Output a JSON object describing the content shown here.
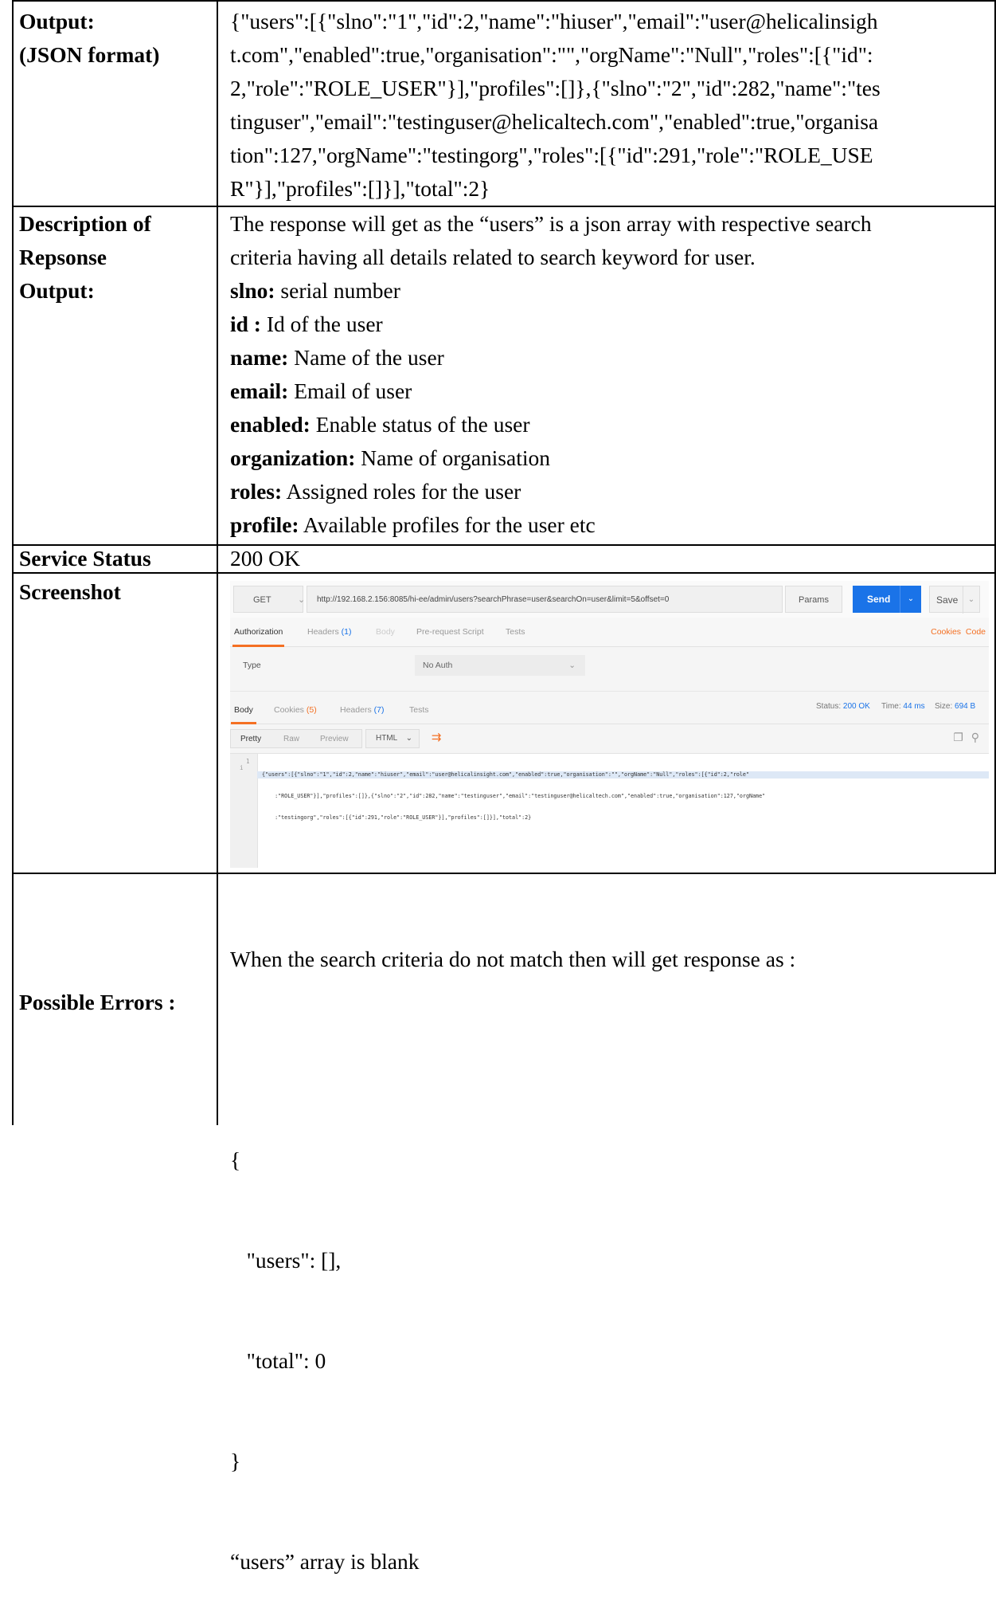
{
  "rows": {
    "output": {
      "label_lines": [
        "Output:",
        "(JSON format)"
      ],
      "value_lines": [
        "{\"users\":[{\"slno\":\"1\",\"id\":2,\"name\":\"hiuser\",\"email\":\"user@helicalinsigh",
        "t.com\",\"enabled\":true,\"organisation\":\"\",\"orgName\":\"Null\",\"roles\":[{\"id\":",
        "2,\"role\":\"ROLE_USER\"}],\"profiles\":[]},{\"slno\":\"2\",\"id\":282,\"name\":\"tes",
        "tinguser\",\"email\":\"testinguser@helicaltech.com\",\"enabled\":true,\"organisa",
        "tion\":127,\"orgName\":\"testingorg\",\"roles\":[{\"id\":291,\"role\":\"ROLE_USE",
        "R\"}],\"profiles\":[]}],\"total\":2}"
      ]
    },
    "description": {
      "label_lines": [
        "Description of",
        "Repsonse",
        "Output:"
      ],
      "intro_lines": [
        "The response will get as the “users” is a json array with respective search",
        "criteria having all details related to search keyword for user."
      ],
      "fields": [
        {
          "key": "slno:",
          "text": " serial number"
        },
        {
          "key": "id :",
          "text": " Id of the user"
        },
        {
          "key": "name:",
          "text": " Name of the user"
        },
        {
          "key": "email:",
          "text": " Email of user"
        },
        {
          "key": "enabled:",
          "text": " Enable status of the user"
        },
        {
          "key": "organization:",
          "text": " Name of organisation"
        },
        {
          "key": "roles:",
          "text": " Assigned roles for the user"
        },
        {
          "key": "profile:",
          "text": " Available profiles for the user etc"
        }
      ]
    },
    "status": {
      "label": "Service Status",
      "value": "200 OK"
    },
    "screenshot": {
      "label": "Screenshot"
    },
    "errors": {
      "label": "Possible Errors :",
      "lines": [
        "When the search criteria do not match then will get response as :",
        "",
        "{",
        "   \"users\": [],",
        "   \"total\": 0",
        "}",
        "“users” array is blank"
      ]
    }
  },
  "postman": {
    "method": "GET",
    "url": "http://192.168.2.156:8085/hi-ee/admin/users?searchPhrase=user&searchOn=user&limit=5&offset=0",
    "params_label": "Params",
    "send_label": "Send",
    "save_label": "Save",
    "request_tabs": [
      "Authorization",
      "Headers",
      "Body",
      "Pre-request Script",
      "Tests"
    ],
    "headers_count": "(1)",
    "links": "Cookies  Code",
    "type_label": "Type",
    "type_value": "No Auth",
    "response_tabs": [
      "Body",
      "Cookies",
      "Headers",
      "Tests"
    ],
    "cookies_count": "(5)",
    "resp_headers_count": "(7)",
    "status_label": "Status:",
    "status_value": "200 OK",
    "time_label": "Time:",
    "time_value": "44 ms",
    "size_label": "Size:",
    "size_value": "694 B",
    "view_modes": [
      "Pretty",
      "Raw",
      "Preview"
    ],
    "format": "HTML",
    "gutter": [
      "1",
      "i"
    ],
    "code_lines": [
      "{\"users\":[{\"slno\":\"1\",\"id\":2,\"name\":\"hiuser\",\"email\":\"user@helicalinsight.com\",\"enabled\":true,\"organisation\":\"\",\"orgName\":\"Null\",\"roles\":[{\"id\":2,\"role\"",
      "    :\"ROLE_USER\"}],\"profiles\":[]},{\"slno\":\"2\",\"id\":282,\"name\":\"testinguser\",\"email\":\"testinguser@helicaltech.com\",\"enabled\":true,\"organisation\":127,\"orgName\"",
      "    :\"testingorg\",\"roles\":[{\"id\":291,\"role\":\"ROLE_USER\"}],\"profiles\":[]}],\"total\":2}"
    ]
  }
}
